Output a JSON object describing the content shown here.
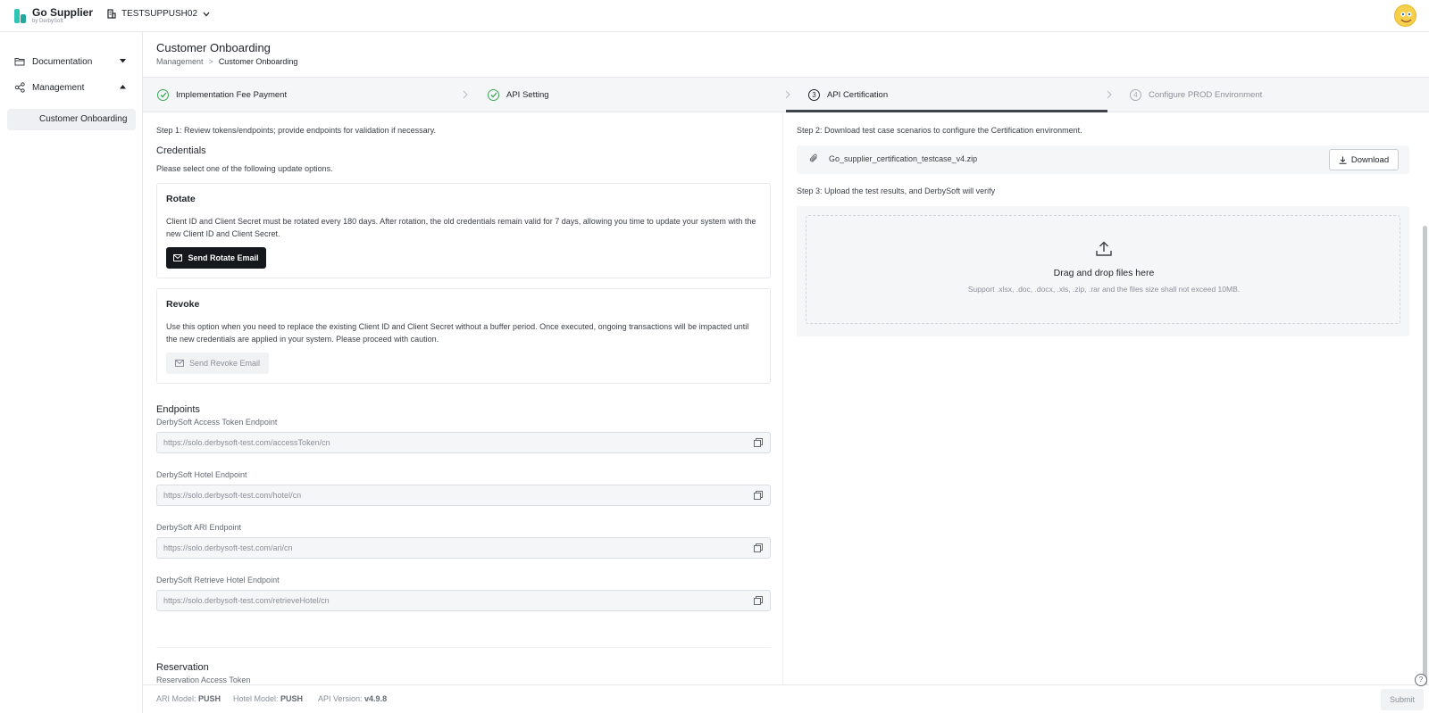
{
  "app": {
    "title": "Go Supplier",
    "subtitle": "by DerbySoft"
  },
  "tenant": {
    "name": "TESTSUPPUSH02"
  },
  "sidebar": {
    "items": [
      {
        "label": "Documentation",
        "icon": "folder-icon",
        "expanded": false
      },
      {
        "label": "Management",
        "icon": "share-icon",
        "expanded": true
      }
    ],
    "sub_item": "Customer Onboarding"
  },
  "header": {
    "title": "Customer Onboarding",
    "breadcrumb": [
      "Management",
      ">",
      "Customer Onboarding"
    ]
  },
  "stepper": {
    "steps": [
      {
        "label": "Implementation Fee Payment",
        "status": "done"
      },
      {
        "label": "API Setting",
        "status": "done"
      },
      {
        "number": "3",
        "label": "API Certification",
        "status": "active"
      },
      {
        "number": "4",
        "label": "Configure PROD Environment",
        "status": "todo"
      }
    ]
  },
  "left": {
    "step1": "Step 1: Review tokens/endpoints; provide endpoints for validation if necessary.",
    "credentials_title": "Credentials",
    "credentials_hint": "Please select one of the following update options.",
    "rotate": {
      "title": "Rotate",
      "text": "Client ID and Client Secret must be rotated every 180 days. After rotation, the old credentials remain valid for 7 days, allowing you time to update your system with the new Client ID and Client Secret.",
      "button": "Send Rotate Email"
    },
    "revoke": {
      "title": "Revoke",
      "text": "Use this option when you need to replace the existing Client ID and Client Secret without a buffer period. Once executed, ongoing transactions will be impacted until the new credentials are applied in your system. Please proceed with caution.",
      "button": "Send Revoke Email"
    },
    "endpoints_title": "Endpoints",
    "endpoints": [
      {
        "label": "DerbySoft Access Token Endpoint",
        "value": "https://solo.derbysoft-test.com/accessToken/cn"
      },
      {
        "label": "DerbySoft Hotel Endpoint",
        "value": "https://solo.derbysoft-test.com/hotel/cn"
      },
      {
        "label": "DerbySoft ARI Endpoint",
        "value": "https://solo.derbysoft-test.com/ari/cn"
      },
      {
        "label": "DerbySoft Retrieve Hotel Endpoint",
        "value": "https://solo.derbysoft-test.com/retrieveHotel/cn"
      }
    ],
    "reservation_title": "Reservation",
    "reservation_label": "Reservation Access Token"
  },
  "right": {
    "step2": "Step 2: Download test case scenarios to configure the Certification environment.",
    "file_name": "Go_supplier_certification_testcase_v4.zip",
    "download_label": "Download",
    "step3": "Step 3: Upload the test results, and DerbySoft will verify",
    "drop_title": "Drag and drop files here",
    "drop_hint": "Support .xlsx, .doc, .docx, .xls, .zip, .rar and the files size shall not exceed 10MB."
  },
  "footer": {
    "ari_label": "ARI Model:",
    "ari_value": "PUSH",
    "hotel_label": "Hotel Model:",
    "hotel_value": "PUSH",
    "api_label": "API Version:",
    "api_value": "v4.9.8",
    "submit_label": "Submit"
  },
  "help_label": "?",
  "colors": {
    "accent": "#2ec4b6",
    "success": "#3aa757",
    "primary_dark": "#15181c"
  }
}
